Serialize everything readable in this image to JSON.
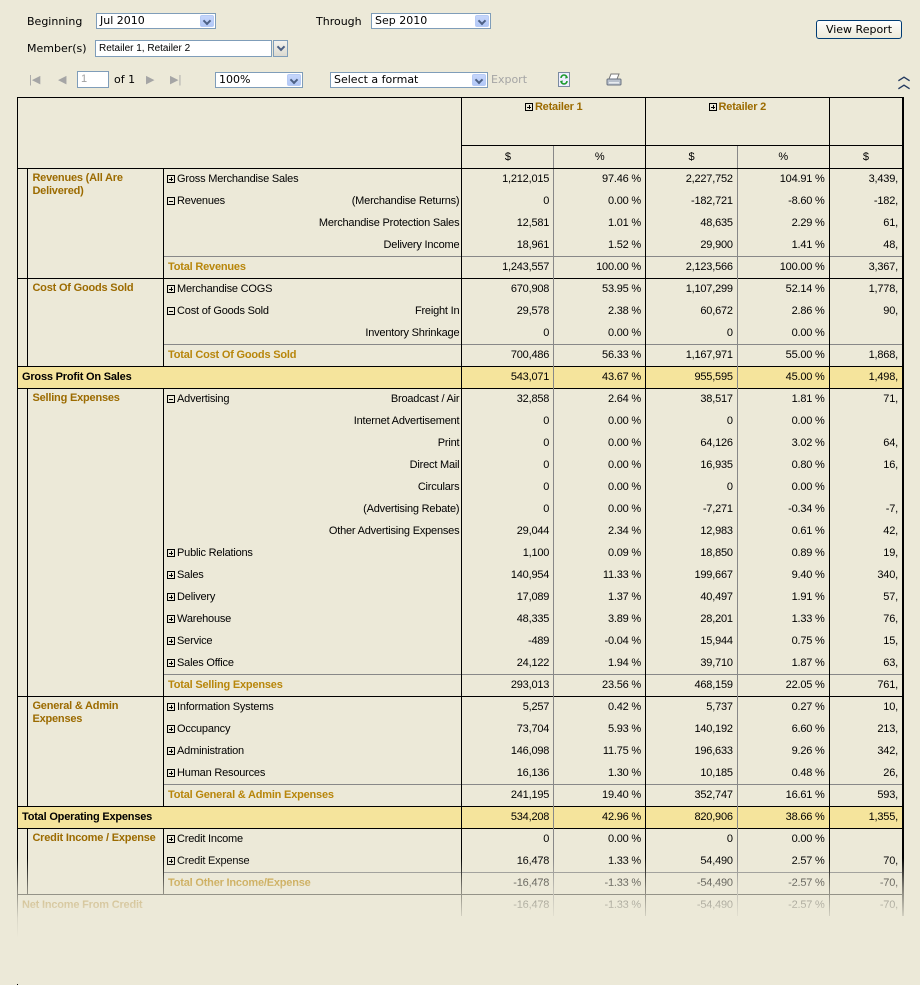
{
  "params": {
    "beginning_label": "Beginning",
    "beginning_value": "Jul 2010",
    "through_label": "Through",
    "through_value": "Sep 2010",
    "members_label": "Member(s)",
    "members_value": "Retailer 1, Retailer 2",
    "view_report": "View Report"
  },
  "toolbar": {
    "page_value": "1",
    "page_of": "of 1",
    "zoom_value": "100%",
    "format_value": "Select a format",
    "export_label": "Export",
    "icons": [
      "first-page-icon",
      "prev-page-icon",
      "next-page-icon",
      "last-page-icon",
      "refresh-icon",
      "print-icon",
      "collapse-icon"
    ]
  },
  "report": {
    "columns": [
      {
        "name": "Retailer 1",
        "units": [
          "$",
          "%"
        ]
      },
      {
        "name": "Retailer 2",
        "units": [
          "$",
          "%"
        ]
      },
      {
        "name": "",
        "units": [
          "$"
        ]
      }
    ],
    "sections": [
      {
        "title": "Revenues (All Are Delivered)",
        "rows": [
          {
            "label": "Gross Merchandise Sales",
            "icon": "plus",
            "sub": "",
            "v": [
              "1,212,015",
              "97.46 %",
              "2,227,752",
              "104.91 %",
              "3,439,"
            ]
          },
          {
            "label": "Revenues",
            "icon": "minus",
            "sub": "(Merchandise Returns)",
            "v": [
              "0",
              "0.00 %",
              "-182,721",
              "-8.60 %",
              "-182,"
            ]
          },
          {
            "label": "",
            "icon": "",
            "sub": "Merchandise Protection Sales",
            "v": [
              "12,581",
              "1.01 %",
              "48,635",
              "2.29 %",
              "61,"
            ]
          },
          {
            "label": "",
            "icon": "",
            "sub": "Delivery Income",
            "v": [
              "18,961",
              "1.52 %",
              "29,900",
              "1.41 %",
              "48,"
            ]
          }
        ],
        "total": {
          "label": "Total Revenues",
          "v": [
            "1,243,557",
            "100.00 %",
            "2,123,566",
            "100.00 %",
            "3,367,"
          ]
        }
      },
      {
        "title": "Cost Of Goods Sold",
        "rows": [
          {
            "label": "Merchandise COGS",
            "icon": "plus",
            "sub": "",
            "v": [
              "670,908",
              "53.95 %",
              "1,107,299",
              "52.14 %",
              "1,778,"
            ]
          },
          {
            "label": "Cost of Goods Sold",
            "icon": "minus",
            "sub": "Freight In",
            "v": [
              "29,578",
              "2.38 %",
              "60,672",
              "2.86 %",
              "90,"
            ]
          },
          {
            "label": "",
            "icon": "",
            "sub": "Inventory Shrinkage",
            "v": [
              "0",
              "0.00 %",
              "0",
              "0.00 %",
              ""
            ]
          }
        ],
        "total": {
          "label": "Total Cost Of Goods Sold",
          "v": [
            "700,486",
            "56.33 %",
            "1,167,971",
            "55.00 %",
            "1,868,"
          ]
        }
      },
      {
        "highlight": {
          "label": "Gross Profit On Sales",
          "v": [
            "543,071",
            "43.67 %",
            "955,595",
            "45.00 %",
            "1,498,"
          ]
        }
      },
      {
        "title": "Selling Expenses",
        "rows": [
          {
            "label": "Advertising",
            "icon": "minus",
            "sub": "Broadcast / Air",
            "v": [
              "32,858",
              "2.64 %",
              "38,517",
              "1.81 %",
              "71,"
            ]
          },
          {
            "label": "",
            "icon": "",
            "sub": "Internet Advertisement",
            "v": [
              "0",
              "0.00 %",
              "0",
              "0.00 %",
              ""
            ]
          },
          {
            "label": "",
            "icon": "",
            "sub": "Print",
            "v": [
              "0",
              "0.00 %",
              "64,126",
              "3.02 %",
              "64,"
            ]
          },
          {
            "label": "",
            "icon": "",
            "sub": "Direct Mail",
            "v": [
              "0",
              "0.00 %",
              "16,935",
              "0.80 %",
              "16,"
            ]
          },
          {
            "label": "",
            "icon": "",
            "sub": "Circulars",
            "v": [
              "0",
              "0.00 %",
              "0",
              "0.00 %",
              ""
            ]
          },
          {
            "label": "",
            "icon": "",
            "sub": "(Advertising Rebate)",
            "v": [
              "0",
              "0.00 %",
              "-7,271",
              "-0.34 %",
              "-7,"
            ]
          },
          {
            "label": "",
            "icon": "",
            "sub": "Other Advertising Expenses",
            "v": [
              "29,044",
              "2.34 %",
              "12,983",
              "0.61 %",
              "42,"
            ]
          },
          {
            "label": "Public Relations",
            "icon": "plus",
            "sub": "",
            "v": [
              "1,100",
              "0.09 %",
              "18,850",
              "0.89 %",
              "19,"
            ]
          },
          {
            "label": "Sales",
            "icon": "plus",
            "sub": "",
            "v": [
              "140,954",
              "11.33 %",
              "199,667",
              "9.40 %",
              "340,"
            ]
          },
          {
            "label": "Delivery",
            "icon": "plus",
            "sub": "",
            "v": [
              "17,089",
              "1.37 %",
              "40,497",
              "1.91 %",
              "57,"
            ]
          },
          {
            "label": "Warehouse",
            "icon": "plus",
            "sub": "",
            "v": [
              "48,335",
              "3.89 %",
              "28,201",
              "1.33 %",
              "76,"
            ]
          },
          {
            "label": "Service",
            "icon": "plus",
            "sub": "",
            "v": [
              "-489",
              "-0.04 %",
              "15,944",
              "0.75 %",
              "15,"
            ]
          },
          {
            "label": "Sales Office",
            "icon": "plus",
            "sub": "",
            "v": [
              "24,122",
              "1.94 %",
              "39,710",
              "1.87 %",
              "63,"
            ]
          }
        ],
        "total": {
          "label": "Total Selling Expenses",
          "v": [
            "293,013",
            "23.56 %",
            "468,159",
            "22.05 %",
            "761,"
          ]
        }
      },
      {
        "title": "General & Admin Expenses",
        "rows": [
          {
            "label": "Information Systems",
            "icon": "plus",
            "sub": "",
            "v": [
              "5,257",
              "0.42 %",
              "5,737",
              "0.27 %",
              "10,"
            ]
          },
          {
            "label": "Occupancy",
            "icon": "plus",
            "sub": "",
            "v": [
              "73,704",
              "5.93 %",
              "140,192",
              "6.60 %",
              "213,"
            ]
          },
          {
            "label": "Administration",
            "icon": "plus",
            "sub": "",
            "v": [
              "146,098",
              "11.75 %",
              "196,633",
              "9.26 %",
              "342,"
            ]
          },
          {
            "label": "Human Resources",
            "icon": "plus",
            "sub": "",
            "v": [
              "16,136",
              "1.30 %",
              "10,185",
              "0.48 %",
              "26,"
            ]
          }
        ],
        "total": {
          "label": "Total General & Admin Expenses",
          "v": [
            "241,195",
            "19.40 %",
            "352,747",
            "16.61 %",
            "593,"
          ]
        }
      },
      {
        "highlight": {
          "label": "Total Operating Expenses",
          "v": [
            "534,208",
            "42.96 %",
            "820,906",
            "38.66 %",
            "1,355,"
          ]
        }
      },
      {
        "title": "Credit Income / Expense",
        "rows": [
          {
            "label": "Credit Income",
            "icon": "plus",
            "sub": "",
            "v": [
              "0",
              "0.00 %",
              "0",
              "0.00 %",
              ""
            ]
          },
          {
            "label": "Credit Expense",
            "icon": "plus",
            "sub": "",
            "v": [
              "16,478",
              "1.33 %",
              "54,490",
              "2.57 %",
              "70,"
            ]
          }
        ],
        "total": {
          "label": "Total Other Income/Expense",
          "v": [
            "-16,478",
            "-1.33 %",
            "-54,490",
            "-2.57 %",
            "-70,"
          ]
        }
      },
      {
        "plain": {
          "label": "Net Income From Credit",
          "v": [
            "-16,478",
            "-1.33 %",
            "-54,490",
            "-2.57 %",
            "-70,"
          ]
        }
      }
    ]
  }
}
